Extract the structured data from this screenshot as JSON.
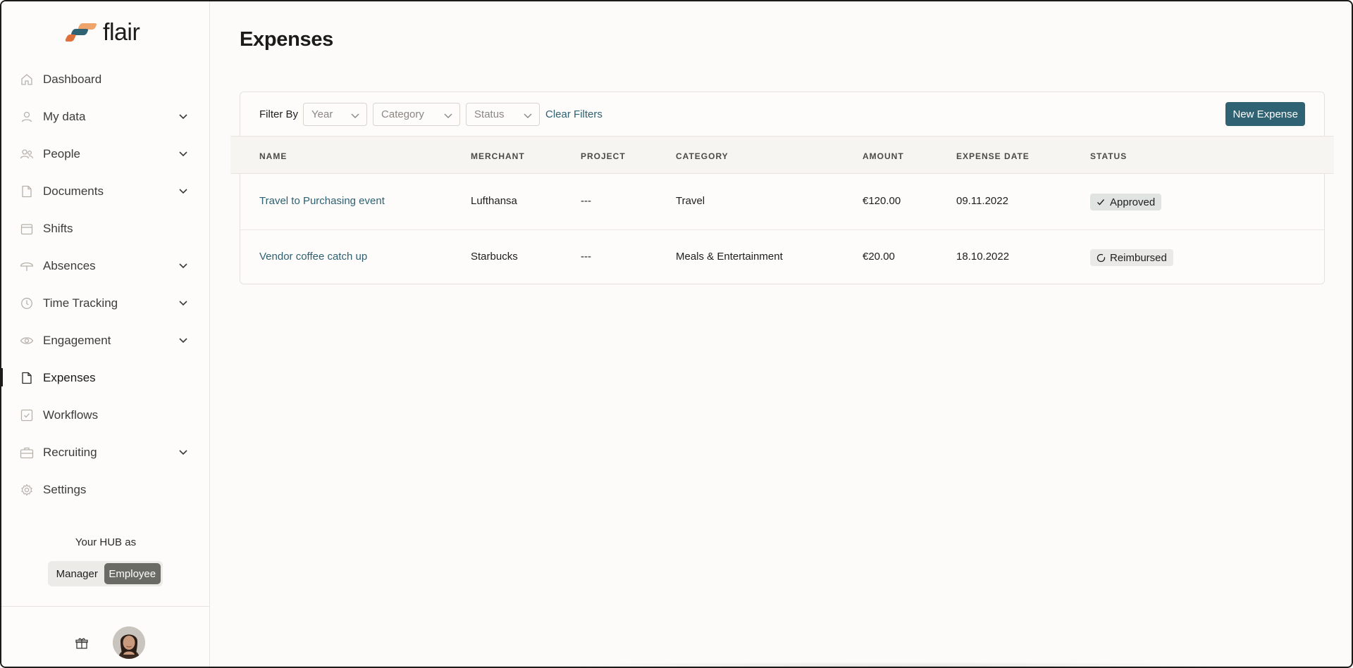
{
  "app": {
    "brand": "flair",
    "colors": {
      "accent": "#2f6373",
      "link": "#2d6070",
      "logo_orange": "#e0703a",
      "logo_peach": "#efa46b",
      "logo_teal": "#2f6373"
    }
  },
  "sidebar": {
    "items": [
      {
        "label": "Dashboard",
        "icon": "home-icon",
        "expandable": false
      },
      {
        "label": "My data",
        "icon": "user-icon",
        "expandable": true
      },
      {
        "label": "People",
        "icon": "people-icon",
        "expandable": true
      },
      {
        "label": "Documents",
        "icon": "document-icon",
        "expandable": true
      },
      {
        "label": "Shifts",
        "icon": "calendar-icon",
        "expandable": false
      },
      {
        "label": "Absences",
        "icon": "umbrella-icon",
        "expandable": true
      },
      {
        "label": "Time Tracking",
        "icon": "clock-icon",
        "expandable": true
      },
      {
        "label": "Engagement",
        "icon": "eye-icon",
        "expandable": true
      },
      {
        "label": "Expenses",
        "icon": "file-icon",
        "expandable": false,
        "active": true
      },
      {
        "label": "Workflows",
        "icon": "checkbox-icon",
        "expandable": false
      },
      {
        "label": "Recruiting",
        "icon": "briefcase-icon",
        "expandable": true
      },
      {
        "label": "Settings",
        "icon": "gear-icon",
        "expandable": false
      }
    ],
    "hub_label": "Your HUB as",
    "roles": {
      "manager": "Manager",
      "employee": "Employee",
      "selected": "Employee"
    }
  },
  "main": {
    "title": "Expenses",
    "filters": {
      "label": "Filter By",
      "year_placeholder": "Year",
      "category_placeholder": "Category",
      "status_placeholder": "Status",
      "clear": "Clear Filters"
    },
    "new_button": "New Expense",
    "columns": [
      "NAME",
      "MERCHANT",
      "PROJECT",
      "CATEGORY",
      "AMOUNT",
      "EXPENSE DATE",
      "STATUS"
    ],
    "rows": [
      {
        "name": "Travel to Purchasing event",
        "merchant": "Lufthansa",
        "project": "---",
        "category": "Travel",
        "amount": "€120.00",
        "date": "09.11.2022",
        "status": "Approved",
        "status_icon": "check-icon",
        "status_color": "#dfe3e1"
      },
      {
        "name": "Vendor coffee catch up",
        "merchant": "Starbucks",
        "project": "---",
        "category": "Meals & Entertainment",
        "amount": "€20.00",
        "date": "18.10.2022",
        "status": "Reimbursed",
        "status_icon": "circle-icon",
        "status_color": "#ebe9e5"
      }
    ]
  }
}
